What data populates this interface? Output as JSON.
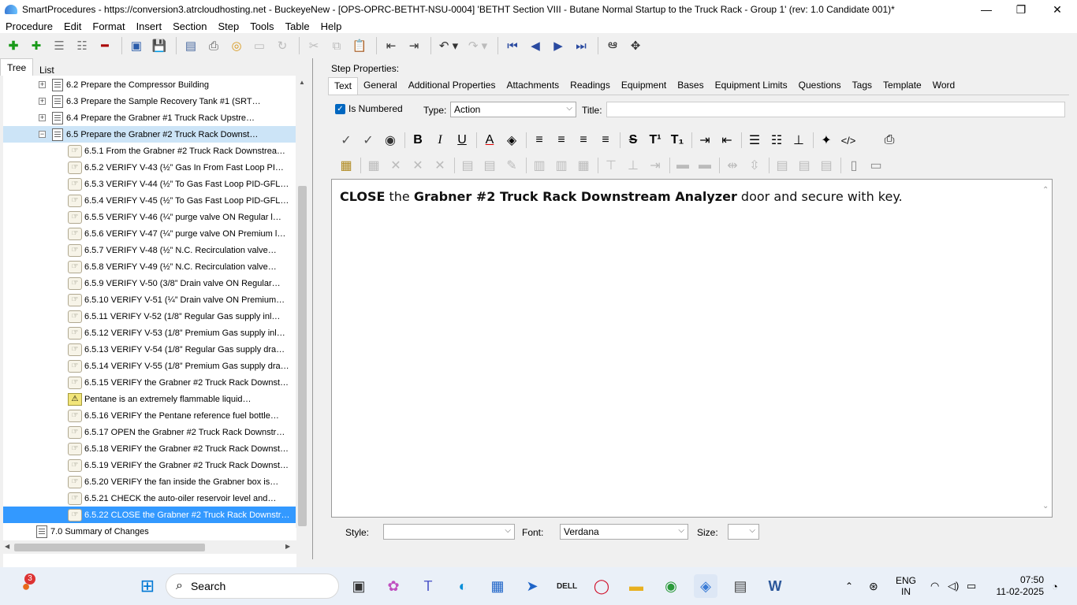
{
  "window": {
    "title": "SmartProcedures - https://conversion3.atrcloudhosting.net - BuckeyeNew - [OPS-OPRC-BETHT-NSU-0004] 'BETHT Section VIII - Butane Normal Startup to the Truck Rack - Group 1' (rev: 1.0 Candidate 001)*",
    "minimize_glyph": "—",
    "restore_glyph": "❐",
    "close_glyph": "✕"
  },
  "menu": [
    "Procedure",
    "Edit",
    "Format",
    "Insert",
    "Section",
    "Step",
    "Tools",
    "Table",
    "Help"
  ],
  "left": {
    "tabs": [
      "Tree",
      "List"
    ],
    "tree": [
      {
        "label": "6.2 Prepare the Compressor Building",
        "kind": "section",
        "expander": "+"
      },
      {
        "label": "6.3 Prepare the Sample Recovery Tank #1 (SRT…",
        "kind": "section",
        "expander": "+"
      },
      {
        "label": "6.4 Prepare the Grabner #1 Truck Rack Upstre…",
        "kind": "section",
        "expander": "+"
      },
      {
        "label": "6.5 Prepare the Grabner #2 Truck Rack Downst…",
        "kind": "section",
        "expander": "−"
      },
      {
        "label": "6.5.1 From the Grabner #2 Truck Rack Downstrea…",
        "kind": "step"
      },
      {
        "label": "6.5.2 VERIFY V-43 (½” Gas In From Fast Loop PI…",
        "kind": "step"
      },
      {
        "label": "6.5.3 VERIFY V-44 (½” To Gas Fast Loop PID-GFL…",
        "kind": "step"
      },
      {
        "label": "6.5.4 VERIFY V-45 (½” To Gas Fast Loop PID-GFL…",
        "kind": "step"
      },
      {
        "label": "6.5.5 VERIFY V-46 (¼” purge valve ON Regular l…",
        "kind": "step"
      },
      {
        "label": "6.5.6 VERIFY V-47 (¼” purge valve ON Premium l…",
        "kind": "step"
      },
      {
        "label": "6.5.7 VERIFY V-48 (½” N.C. Recirculation valve…",
        "kind": "step"
      },
      {
        "label": "6.5.8 VERIFY V-49 (½” N.C. Recirculation valve…",
        "kind": "step"
      },
      {
        "label": "6.5.9 VERIFY V-50 (3/8” Drain valve ON Regular…",
        "kind": "step"
      },
      {
        "label": "6.5.10 VERIFY V-51 (¼” Drain valve ON Premium…",
        "kind": "step"
      },
      {
        "label": "6.5.11 VERIFY V-52 (1/8” Regular Gas supply inl…",
        "kind": "step"
      },
      {
        "label": "6.5.12 VERIFY V-53 (1/8” Premium Gas supply inl…",
        "kind": "step"
      },
      {
        "label": "6.5.13 VERIFY V-54 (1/8” Regular Gas supply dra…",
        "kind": "step"
      },
      {
        "label": "6.5.14 VERIFY V-55 (1/8” Premium Gas supply dra…",
        "kind": "step"
      },
      {
        "label": "6.5.15 VERIFY the Grabner #2 Truck Rack Downst…",
        "kind": "step"
      },
      {
        "label": "Pentane is an extremely flammable liquid…",
        "kind": "warning"
      },
      {
        "label": "6.5.16 VERIFY the Pentane reference fuel bottle…",
        "kind": "step"
      },
      {
        "label": "6.5.17 OPEN the Grabner #2 Truck Rack Downstr…",
        "kind": "step"
      },
      {
        "label": "6.5.18 VERIFY the Grabner #2 Truck Rack Downst…",
        "kind": "step"
      },
      {
        "label": "6.5.19 VERIFY the Grabner #2 Truck Rack Downst…",
        "kind": "step"
      },
      {
        "label": "6.5.20 VERIFY the fan inside the Grabner box is…",
        "kind": "step"
      },
      {
        "label": "6.5.21 CHECK the auto-oiler reservoir level and…",
        "kind": "step"
      },
      {
        "label": "6.5.22 CLOSE the Grabner #2 Truck Rack Downstr…",
        "kind": "step"
      },
      {
        "label": "7.0 Summary of Changes",
        "kind": "section0"
      }
    ]
  },
  "right": {
    "step_properties_label": "Step Properties:",
    "tabs": [
      "Text",
      "General",
      "Additional Properties",
      "Attachments",
      "Readings",
      "Equipment",
      "Bases",
      "Equipment Limits",
      "Questions",
      "Tags",
      "Template",
      "Word"
    ],
    "is_numbered_label": "Is Numbered",
    "type_label": "Type:",
    "type_value": "Action",
    "title_label": "Title:",
    "title_value": "",
    "editor": {
      "w1": "CLOSE",
      "w2": " the ",
      "w3": "Grabner #2 Truck Rack Downstream Analyzer",
      "w4": " door and secure with key."
    },
    "style_label": "Style:",
    "style_value": "",
    "font_label": "Font:",
    "font_value": "Verdana",
    "size_label": "Size:",
    "size_value": ""
  },
  "taskbar": {
    "search_placeholder": "Search",
    "badge": "3",
    "lang1": "ENG",
    "lang2": "IN",
    "time": "07:50",
    "date": "11-02-2025",
    "dell": "DELL"
  }
}
